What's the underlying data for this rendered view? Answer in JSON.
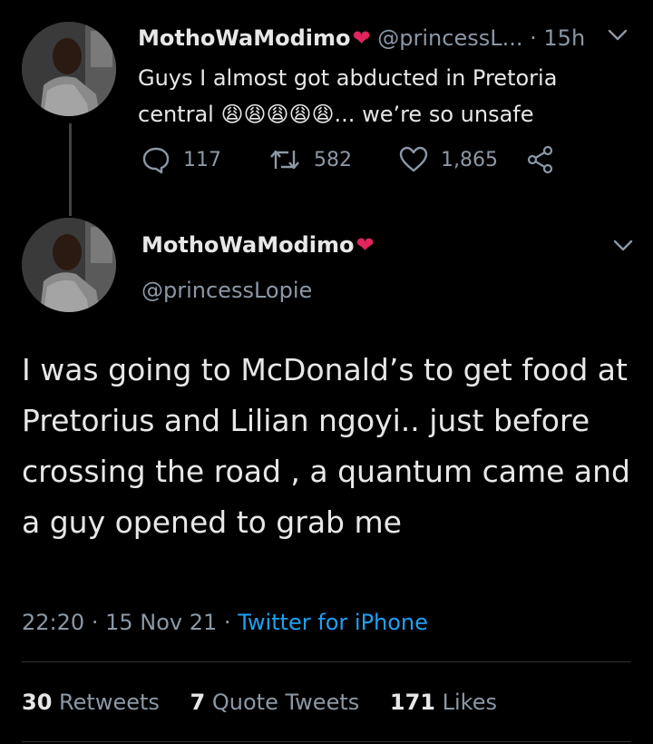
{
  "parent_tweet": {
    "display_name": "MothoWaModimo",
    "heart": "❤",
    "handle_truncated": "@princessL...",
    "time_ago": "15h",
    "text": "Guys I almost got abducted in Pretoria central 😩😩😩😩😩... we’re so unsafe",
    "replies": "117",
    "retweets": "582",
    "likes": "1,865"
  },
  "main_tweet": {
    "display_name": "MothoWaModimo",
    "heart": "❤",
    "handle": "@princessLopie",
    "text": "I was going to McDonald’s to get food at Pretorius and Lilian ngoyi.. just before crossing the road , a quantum came and a guy opened to grab me",
    "time": "22:20",
    "date": "15 Nov 21",
    "source": "Twitter for iPhone",
    "retweet_count": "30",
    "retweet_label": "Retweets",
    "quote_count": "7",
    "quote_label": "Quote Tweets",
    "like_count": "171",
    "like_label": "Likes"
  },
  "colors": {
    "background": "#000000",
    "muted": "#8b98a5",
    "link": "#1da1f2",
    "heart": "#e0245e"
  }
}
